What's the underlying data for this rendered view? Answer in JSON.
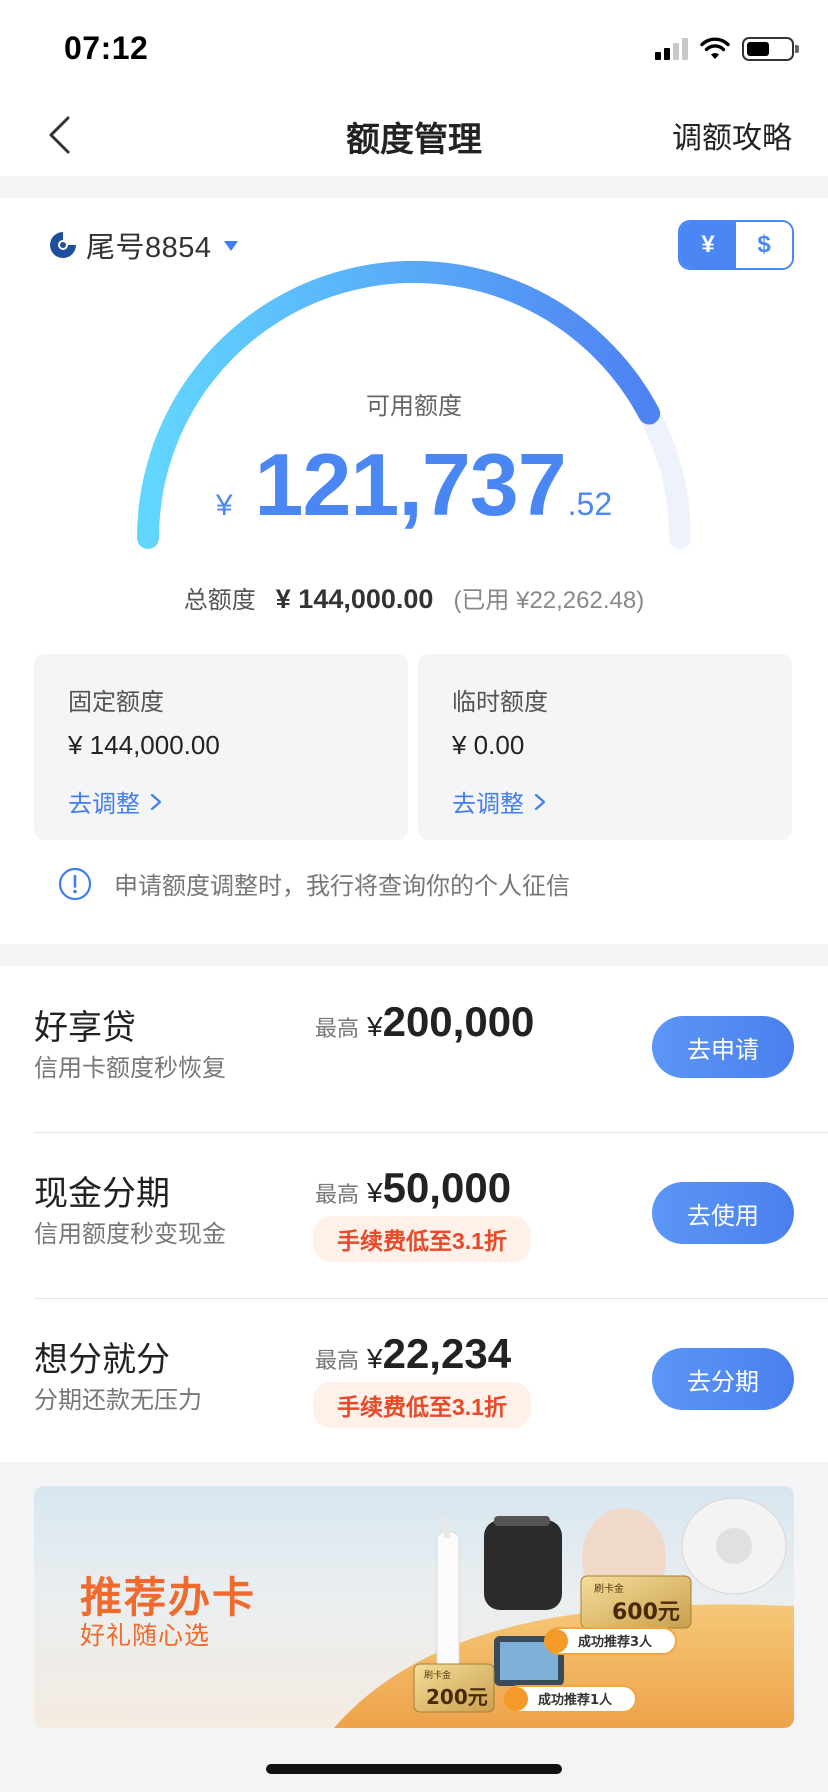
{
  "status_bar": {
    "time": "07:12",
    "icons": [
      "cellular-signal-icon",
      "wifi-icon",
      "battery-icon"
    ]
  },
  "nav": {
    "back_icon": "chevron-left-icon",
    "title": "额度管理",
    "right_link": "调额攻略"
  },
  "account": {
    "bank_icon": "bank-logo-icon",
    "label": "尾号8854"
  },
  "currency_toggle": {
    "options": [
      "¥",
      "$"
    ],
    "selected": "¥"
  },
  "gauge": {
    "caption": "可用额度",
    "currency": "¥",
    "integer_part": "121,737",
    "decimal_part": ".52",
    "fraction_available": 0.845
  },
  "totals": {
    "label": "总额度",
    "total": "¥ 144,000.00",
    "used": "(已用 ¥22,262.48)"
  },
  "sub_limits": [
    {
      "title": "固定额度",
      "value": "¥ 144,000.00",
      "link": "去调整"
    },
    {
      "title": "临时额度",
      "value": "¥ 0.00",
      "link": "去调整"
    }
  ],
  "notice": "申请额度调整时，我行将查询你的个人征信",
  "products": [
    {
      "name": "好享贷",
      "desc": "信用卡额度秒恢复",
      "max_label": "最高",
      "currency": "¥",
      "max_value": "200,000",
      "badge": "",
      "button": "去申请"
    },
    {
      "name": "现金分期",
      "desc": "信用额度秒变现金",
      "max_label": "最高",
      "currency": "¥",
      "max_value": "50,000",
      "badge": "手续费低至3.1折",
      "button": "去使用"
    },
    {
      "name": "想分就分",
      "desc": "分期还款无压力",
      "max_label": "最高",
      "currency": "¥",
      "max_value": "22,234",
      "badge": "手续费低至3.1折",
      "button": "去分期"
    }
  ],
  "promo": {
    "title": "推荐办卡",
    "subtitle": "好礼随心选",
    "card_large": {
      "label": "刷卡金",
      "amount": "600元"
    },
    "card_small": {
      "label": "刷卡金",
      "amount": "200元"
    },
    "ribbon_large": "成功推荐3人",
    "ribbon_small": "成功推荐1人"
  },
  "colors": {
    "accent": "#4a87f5",
    "gauge_start": "#62d6ff",
    "gauge_end": "#4f82f2",
    "fee_text": "#e84a28",
    "promo_text": "#ef6a2c"
  }
}
